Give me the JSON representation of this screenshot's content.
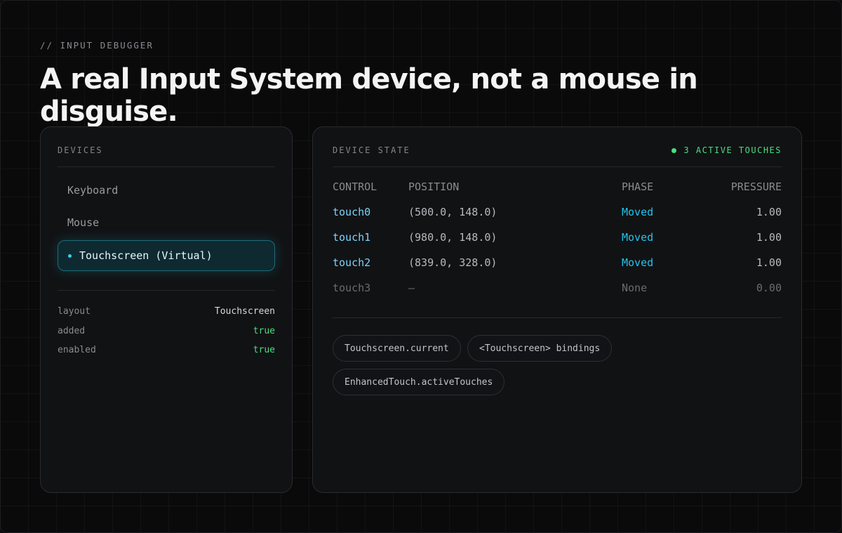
{
  "header": {
    "eyebrow": "// INPUT DEBUGGER",
    "headline": "A real Input System device, not a mouse in disguise."
  },
  "devices": {
    "label": "DEVICES",
    "items": [
      {
        "label": "Keyboard"
      },
      {
        "label": "Mouse"
      },
      {
        "label": "Touchscreen (Virtual)",
        "selected": true
      }
    ],
    "properties": [
      {
        "key": "layout",
        "value": "Touchscreen"
      },
      {
        "key": "added",
        "value": "true"
      },
      {
        "key": "enabled",
        "value": "true"
      }
    ]
  },
  "state": {
    "label": "DEVICE STATE",
    "status": "3 ACTIVE TOUCHES",
    "columns": [
      "CONTROL",
      "POSITION",
      "PHASE",
      "PRESSURE"
    ],
    "rows": [
      {
        "control": "touch0",
        "position": "(500.0, 148.0)",
        "phase": "Moved",
        "pressure": "1.00"
      },
      {
        "control": "touch1",
        "position": "(980.0, 148.0)",
        "phase": "Moved",
        "pressure": "1.00"
      },
      {
        "control": "touch2",
        "position": "(839.0, 328.0)",
        "phase": "Moved",
        "pressure": "1.00"
      },
      {
        "control": "touch3",
        "position": "—",
        "phase": "None",
        "pressure": "0.00"
      }
    ],
    "chips": [
      "Touchscreen.current",
      "<Touchscreen> bindings",
      "EnhancedTouch.activeTouches"
    ]
  },
  "colors": {
    "accent_cyan": "#22c4ee",
    "active_green": "#4ade80",
    "background": "#0a0a0b"
  }
}
